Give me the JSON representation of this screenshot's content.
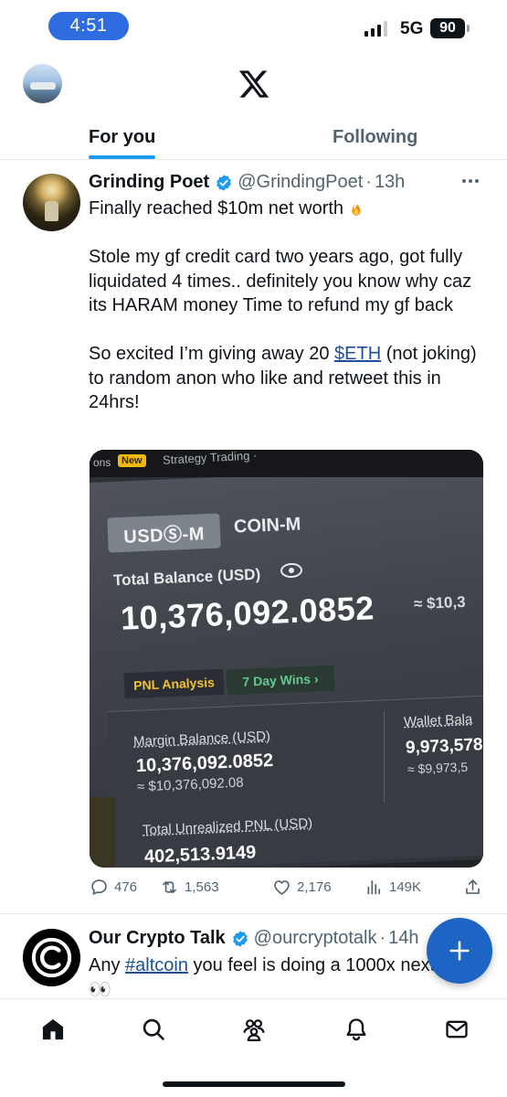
{
  "status_bar": {
    "time": "4:51",
    "network": "5G",
    "battery": "90"
  },
  "tabs": [
    {
      "label": "For you",
      "active": true
    },
    {
      "label": "Following",
      "active": false
    }
  ],
  "tweet": {
    "name": "Grinding Poet",
    "handle": "@GrindingPoet",
    "separator": "·",
    "age": "13h",
    "line1": "Finally reached $10m net worth",
    "para2": "Stole my gf credit card two years ago, got fully liquidated 4 times.. definitely you know why caz its HARAM money Time to refund my gf back",
    "para3_before": "So excited I’m giving away 20 ",
    "para3_cashtag": "$ETH",
    "para3_after": " (not joking) to random anon who like and retweet this in 24hrs!",
    "media": {
      "ons": "ons",
      "new_badge": "New",
      "strategy": "Strategy Trading ·",
      "seg_usds": "USDⓈ-M",
      "seg_coin": "COIN-M",
      "total_label": "Total Balance (USD)",
      "total_value": "10,376,092.0852",
      "total_usd": "≈ $10,3",
      "pnl_label": "PNL Analysis",
      "wins_label": "7 Day Wins ›",
      "margin_label": "Margin Balance (USD)",
      "margin_value": "10,376,092.0852",
      "margin_usd": "≈ $10,376,092.08",
      "wallet_label": "Wallet Bala",
      "wallet_value": "9,973,578",
      "wallet_usd": "≈ $9,973,5",
      "unreal_label": "Total Unrealized PNL (USD)",
      "unreal_value": "402,513.9149"
    },
    "stats": {
      "replies": "476",
      "reposts": "1,563",
      "likes": "2,176",
      "views": "149K"
    }
  },
  "tweet2": {
    "name": "Our Crypto Talk",
    "handle": "@ourcryptotalk",
    "separator": "·",
    "age": "14h",
    "text_before": "Any ",
    "hashtag": "#altcoin",
    "text_after": " you feel is doing a 1000x next SZN? 👀"
  },
  "colors": {
    "accent": "#1d9bf0",
    "fab": "#1d64c4",
    "link": "#1d4f9c",
    "time_pill": "#2f6ce0"
  },
  "icons": [
    "x-logo-icon",
    "verified-icon",
    "fire-icon",
    "more-icon",
    "reply-icon",
    "repost-icon",
    "like-icon",
    "views-icon",
    "share-icon",
    "compose-icon",
    "home-icon",
    "search-icon",
    "communities-icon",
    "notifications-icon",
    "messages-icon"
  ]
}
